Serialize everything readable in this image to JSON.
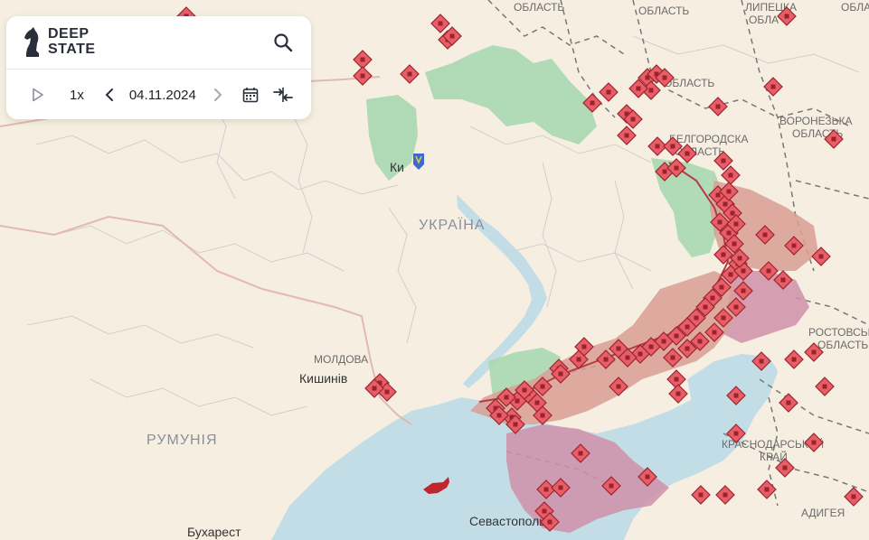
{
  "app": {
    "logo_line1": "DEEP",
    "logo_line2": "STATE"
  },
  "controls": {
    "speed": "1x",
    "date": "04.11.2024",
    "icons": [
      "play-icon",
      "chevron-left-icon",
      "chevron-right-icon",
      "calendar-icon",
      "compare-icon",
      "search-icon"
    ]
  },
  "map_labels": {
    "kyiv": "Ки",
    "ukraine": "УКРАЇНА",
    "moldova": "МОЛДОВА",
    "chisinau": "Кишинів",
    "romania": "РУМУНІЯ",
    "bucharest": "Бухарест",
    "sevastopol": "Севастополь",
    "oblast_top1": "ОБЛАСТЬ",
    "oblast_top2": "ОБЛАСТЬ",
    "lipetsk_1": "ЛИПЕЦКА",
    "lipetsk_2": "ОБЛА",
    "oblast_top3": "ОБЛАСТЬ",
    "kursk_oblast": "ОБЛАСТЬ",
    "belgorod_1": "БЕЛГОРОДСКА",
    "belgorod_2": "ОБЛАСТЬ",
    "voronezh_1": "ВОРОНЕЗЬКА",
    "voronezh_2": "ОБЛАСТЬ",
    "rostov_1": "РОСТОВСЬКА",
    "rostov_2": "ОБЛАСТЬ",
    "krasnodar_1": "КРАСНОДАРСЬКИЙ",
    "krasnodar_2": "КРАЙ",
    "adygea": "АДИГЕЯ"
  },
  "colors": {
    "land": "#f6efe1",
    "sea": "#c3dde6",
    "occupied": "#d99e94",
    "occupied_pre2022": "#cf8fa8",
    "liberated": "#a8d8b1",
    "marker": "#e85e66",
    "marker_border": "#9b2330",
    "border": "#c7c7c7"
  }
}
